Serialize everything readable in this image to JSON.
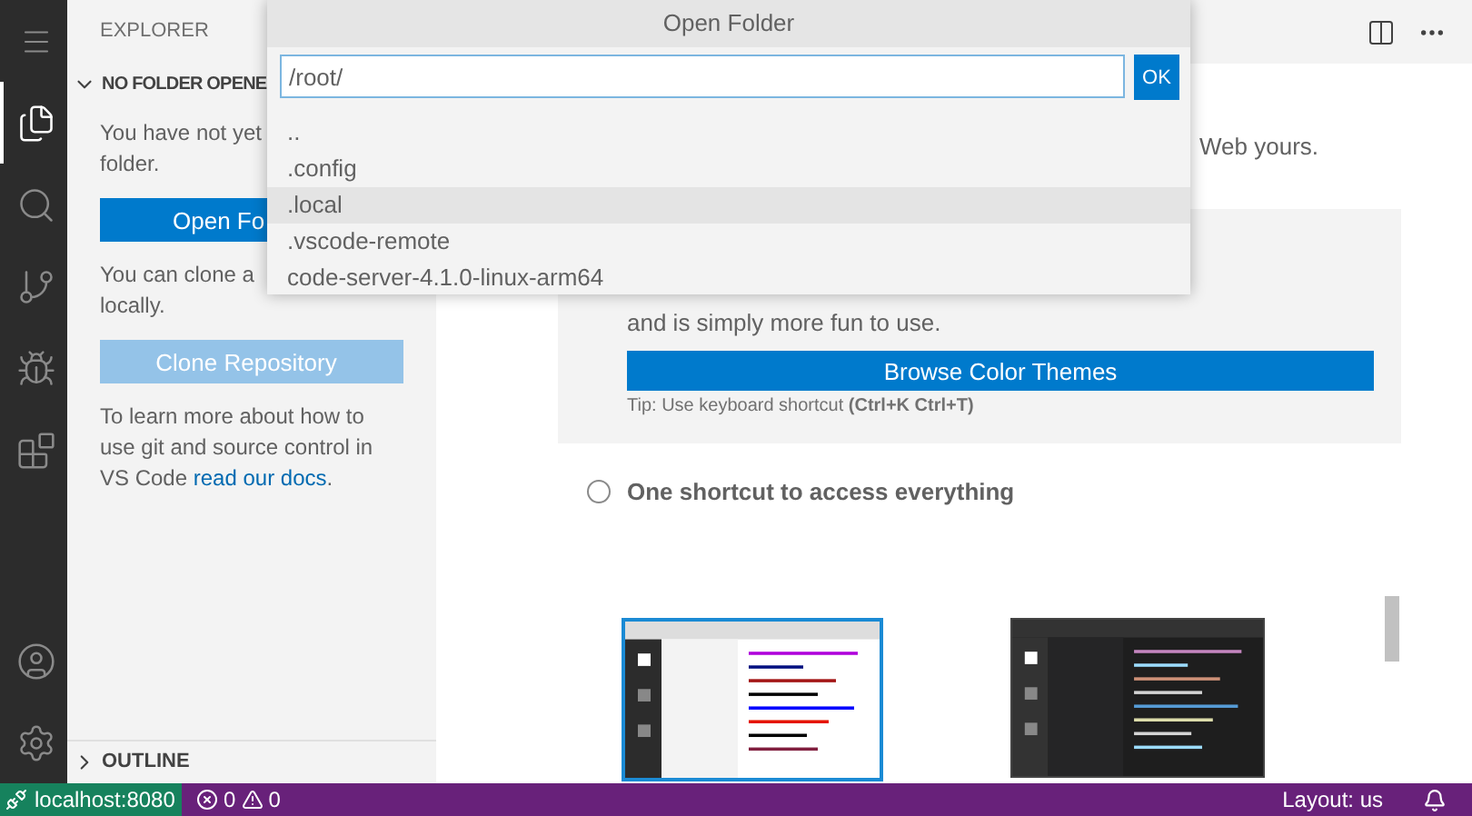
{
  "activity_bar": {
    "items": [
      {
        "kind": "menu",
        "selected": false
      },
      {
        "kind": "explorer",
        "selected": true
      },
      {
        "kind": "search",
        "selected": false
      },
      {
        "kind": "source_control",
        "selected": false
      },
      {
        "kind": "run",
        "selected": false
      },
      {
        "kind": "extensions",
        "selected": false
      }
    ],
    "bottom_items": [
      {
        "kind": "account",
        "selected": false
      },
      {
        "kind": "settings",
        "selected": false
      }
    ]
  },
  "sidebar": {
    "title": "EXPLORER",
    "folder_section": {
      "title": "NO FOLDER OPENE",
      "expanded": true,
      "message_lines": [
        "You have not yet",
        "folder."
      ],
      "open_button": "Open Fo",
      "clone_lines": [
        "You can clone a",
        "locally."
      ],
      "clone_button": "Clone Repository",
      "docs_text": "To learn more about how to use git and source control in VS Code ",
      "docs_link": "read our docs",
      "docs_end": "."
    },
    "outline": {
      "title": "OUTLINE",
      "expanded": false
    }
  },
  "editor": {
    "intro_tail": "Web yours.",
    "theme_card": {
      "text": "and is simply more fun to use.",
      "button": "Browse Color Themes",
      "tip": "Tip: Use keyboard shortcut **(Ctrl+K Ctrl+T)**"
    },
    "steps": [
      {
        "label": "One shortcut to access everything",
        "checked": false
      }
    ],
    "themes": [
      {
        "kind": "light",
        "selected": true
      },
      {
        "kind": "dark",
        "selected": false
      }
    ]
  },
  "dialog": {
    "title": "Open Folder",
    "value": "/root/",
    "ok": "OK",
    "items": [
      {
        "label": "..",
        "selected": false
      },
      {
        "label": ".config",
        "selected": false
      },
      {
        "label": ".local",
        "selected": true
      },
      {
        "label": ".vscode-remote",
        "selected": false
      },
      {
        "label": "code-server-4.1.0-linux-arm64",
        "selected": false
      }
    ]
  },
  "status_bar": {
    "remote": "localhost:8080",
    "errors": "0",
    "warnings": "0",
    "layout": "Layout: us"
  }
}
